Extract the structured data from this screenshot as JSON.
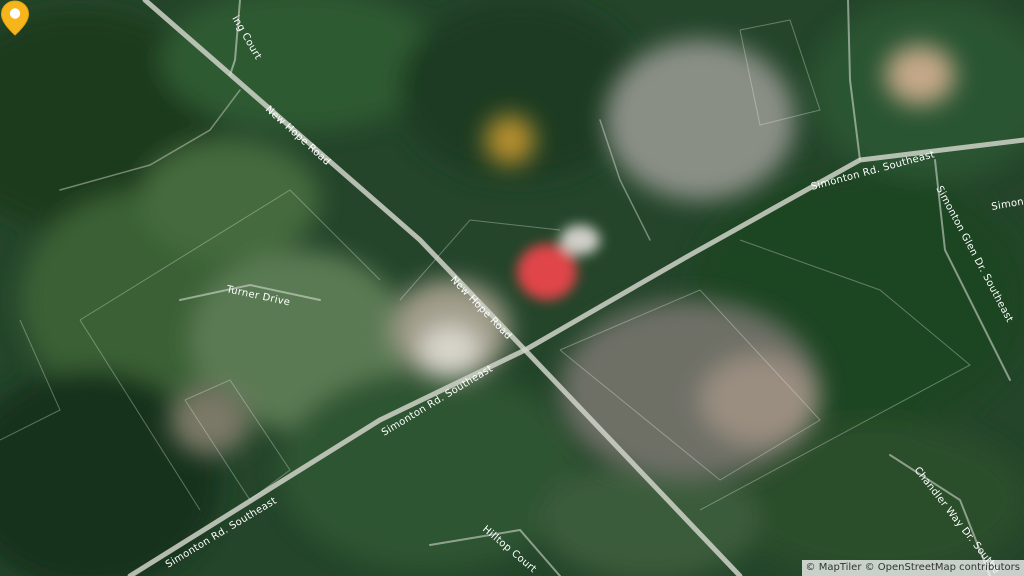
{
  "map": {
    "type": "satellite",
    "pin_color": "#F5B51B",
    "road_labels": {
      "new_hope_road_upper": "New Hope Road",
      "new_hope_road_center": "New Hope Road",
      "simonton_rd_se_east": "Simonton Rd. Southeast",
      "simonton_rd_se_center": "Simonton Rd. Southeast",
      "simonton_rd_se_west": "Simonton Rd. Southeast",
      "simonton_glen_dr_se": "Simonton Glen Dr. Southeast",
      "simonton_edge": "Simon",
      "turner_drive": "Turner Drive",
      "hilltop_court": "Hilltop Court",
      "chandler_way_dr_se": "Chandler Way Dr. Southe",
      "top_court": "ing Court"
    },
    "attribution": "© MapTiler © OpenStreetMap contributors"
  }
}
